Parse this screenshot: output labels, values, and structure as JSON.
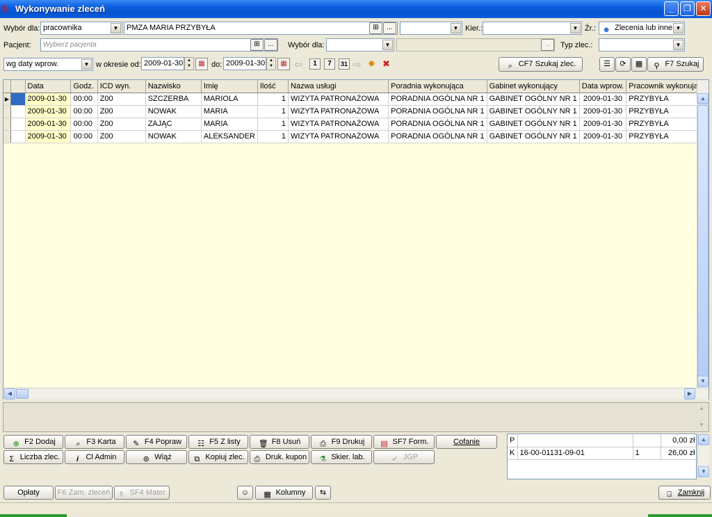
{
  "window": {
    "title": "Wykonywanie zleceń",
    "buttons": {
      "minimize": "_",
      "maximize": "❐",
      "close": "✕"
    }
  },
  "filters": {
    "wybor_dla_label": "Wybór dla:",
    "wybor_dla_value": "pracownika",
    "employee_value": "PMZA MARIA PRZYBYŁA",
    "kier_label": "Kier.:",
    "kier_value": "",
    "zr_label": "Źr.:",
    "zr_value": "Zlecenia lub inne",
    "pacjent_label": "Pacjent:",
    "pacjent_placeholder": "Wybierz pacjenta",
    "wybor_dla2_label": "Wybór dla:",
    "wybor_dla2_value": "",
    "typ_zlec_label": "Typ zlec.:",
    "typ_zlec_value": "",
    "date_mode_value": "wg daty wprow.",
    "okres_label": "w okresie od:",
    "date_from": "2009-01-30",
    "do_label": "do:",
    "date_to": "2009-01-30",
    "cf7_label": "CF7 Szukaj zlec.",
    "f7_label": "F7 Szukaj",
    "ellipsis": "...",
    "day_btn_1": "1",
    "day_btn_7": "7",
    "day_btn_31": "31"
  },
  "grid": {
    "columns": [
      "Data",
      "Godz.",
      "ICD wyn.",
      "Nazwisko",
      "Imię",
      "Ilość",
      "Nazwa usługi",
      "Poradnia wykonująca",
      "Gabinet wykonujący",
      "Data wprow.",
      "Pracownik wykonujący"
    ],
    "rows": [
      [
        "2009-01-30",
        "00:00",
        "Z00",
        "SZCZERBA",
        "MARIOLA",
        "1",
        "WIZYTA PATRONAŻOWA",
        "PORADNIA OGÓLNA NR 1",
        "GABINET OGÓLNY NR 1",
        "2009-01-30",
        "PRZYBYŁA"
      ],
      [
        "2009-01-30",
        "00:00",
        "Z00",
        "NOWAK",
        "MARIA",
        "1",
        "WIZYTA PATRONAŻOWA",
        "PORADNIA OGÓLNA NR 1",
        "GABINET OGÓLNY NR 1",
        "2009-01-30",
        "PRZYBYŁA"
      ],
      [
        "2009-01-30",
        "00:00",
        "Z00",
        "ZAJĄC",
        "MARIA",
        "1",
        "WIZYTA PATRONAŻOWA",
        "PORADNIA OGÓLNA NR 1",
        "GABINET OGÓLNY NR 1",
        "2009-01-30",
        "PRZYBYŁA"
      ],
      [
        "2009-01-30",
        "00:00",
        "Z00",
        "NOWAK",
        "ALEKSANDER",
        "1",
        "WIZYTA PATRONAŻOWA",
        "PORADNIA OGÓLNA NR 1",
        "GABINET OGÓLNY NR 1",
        "2009-01-30",
        "PRZYBYŁA"
      ]
    ]
  },
  "actions": {
    "f2": "F2 Dodaj",
    "f3": "F3 Karta",
    "f4": "F4 Popraw",
    "f5": "F5 Z listy",
    "f8": "F8 Usuń",
    "f9": "F9 Drukuj",
    "sf7": "SF7 Form.",
    "cofanie": "Cofanie",
    "liczba": "Liczba zlec.",
    "cladmin": "Cl Admin",
    "wiaz": "Wiąż",
    "kopiuj": "Kopiuj zlec.",
    "druk_kupon": "Druk. kupon",
    "skier_lab": "Skier. lab.",
    "jgp": "JGP",
    "oplaty": "Opłaty",
    "f6": "F6 Zam. zleceń",
    "sf4": "SF4 Mater.",
    "kolumny": "Kolumny",
    "zamknij": "Zamknij"
  },
  "summary": {
    "rows": [
      {
        "code": "P",
        "desc": "",
        "qty": "",
        "amount": "0,00 zł"
      },
      {
        "code": "K",
        "desc": "16-00-01131-09-01",
        "qty": "1",
        "amount": "26,00 zł"
      }
    ]
  },
  "colors": {
    "titlebar": "#0a5ddd",
    "grid_background": "#ffffe1",
    "date_cell": "#ffffc8",
    "selection": "#316ac5"
  },
  "icons": [
    "app-logo-icon",
    "calendar-icon",
    "search-binoculars-icon",
    "find-magnifier-icon",
    "add-icon",
    "card-icon",
    "edit-icon",
    "list-icon",
    "trash-icon",
    "print-icon",
    "form-icon",
    "sigma-icon",
    "info-icon",
    "link-icon",
    "copy-icon",
    "lab-icon",
    "check-icon",
    "people-add-icon",
    "table-icon",
    "close-door-icon"
  ]
}
